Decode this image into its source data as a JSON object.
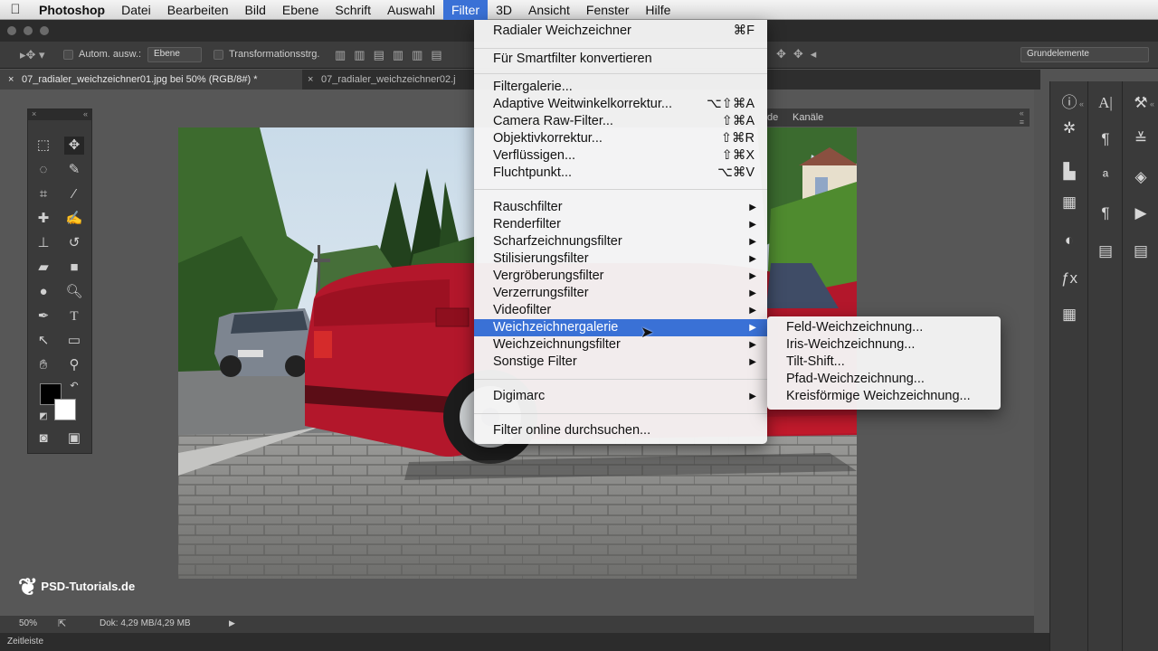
{
  "menubar": {
    "apple": "",
    "items": [
      "Photoshop",
      "Datei",
      "Bearbeiten",
      "Bild",
      "Ebene",
      "Schrift",
      "Auswahl",
      "Filter",
      "3D",
      "Ansicht",
      "Fenster",
      "Hilfe"
    ]
  },
  "options": {
    "auto_select_label": "Autom. ausw.:",
    "auto_select_value": "Ebene",
    "transform_label": "Transformationsstrg.",
    "workspace_value": "Grundelemente"
  },
  "tabs": [
    {
      "close": "×",
      "label": "07_radialer_weichzeichner01.jpg bei 50% (RGB/8#) *"
    },
    {
      "close": "×",
      "label": "07_radialer_weichzeichner02.j"
    }
  ],
  "layers_panel": {
    "tab_partial": "de",
    "tab_channels": "Kanäle"
  },
  "filter_menu": {
    "last_filter": {
      "label": "Radialer Weichzeichner",
      "shortcut": "⌘F"
    },
    "smart": "Für Smartfilter konvertieren",
    "group1": [
      {
        "label": "Filtergalerie...",
        "shortcut": ""
      },
      {
        "label": "Adaptive Weitwinkelkorrektur...",
        "shortcut": "⌥⇧⌘A"
      },
      {
        "label": "Camera Raw-Filter...",
        "shortcut": "⇧⌘A"
      },
      {
        "label": "Objektivkorrektur...",
        "shortcut": "⇧⌘R"
      },
      {
        "label": "Verflüssigen...",
        "shortcut": "⇧⌘X"
      },
      {
        "label": "Fluchtpunkt...",
        "shortcut": "⌥⌘V"
      }
    ],
    "group2": [
      "Rauschfilter",
      "Renderfilter",
      "Scharfzeichnungsfilter",
      "Stilisierungsfilter",
      "Vergröberungsfilter",
      "Verzerrungsfilter",
      "Videofilter",
      "Weichzeichnergalerie",
      "Weichzeichnungsfilter",
      "Sonstige Filter"
    ],
    "digimarc": "Digimarc",
    "online": "Filter online durchsuchen...",
    "arrow": "▶"
  },
  "blur_gallery_submenu": [
    "Feld-Weichzeichnung...",
    "Iris-Weichzeichnung...",
    "Tilt-Shift...",
    "Pfad-Weichzeichnung...",
    "Kreisförmige Weichzeichnung..."
  ],
  "status": {
    "zoom": "50%",
    "doc": "Dok: 4,29 MB/4,29 MB",
    "timeline": "Zeitleiste"
  },
  "watermark": "PSD-Tutorials.de",
  "colors": {
    "highlight": "#3a71d6",
    "car": "#b3172b"
  }
}
